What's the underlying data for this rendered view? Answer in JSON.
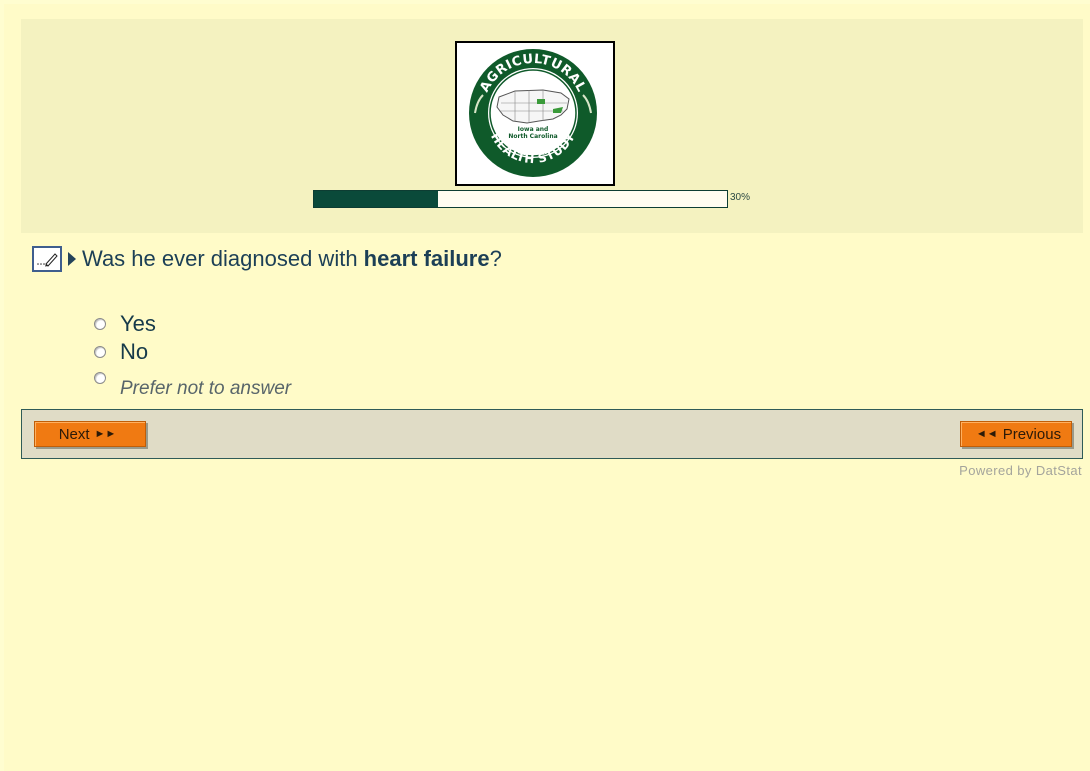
{
  "logo": {
    "alt": "Agricultural Health Study logo",
    "ring_top_text": "AGRICULTURAL",
    "ring_bottom_text": "HEALTH STUDY",
    "center_text_line1": "Iowa and",
    "center_text_line2": "North Carolina"
  },
  "progress": {
    "percent": 30,
    "label": "30%"
  },
  "question": {
    "prefix": "Was he ever diagnosed with ",
    "emphasis": "heart failure",
    "suffix": "?"
  },
  "options": [
    {
      "label": "Yes"
    },
    {
      "label": "No"
    },
    {
      "label": "Prefer not to answer"
    }
  ],
  "navigation": {
    "next_label": "Next",
    "previous_label": "Previous"
  },
  "footer": {
    "powered_by": "Powered by DatStat"
  },
  "colors": {
    "page_background": "#fffbc8",
    "banner_background": "#f4f2c0",
    "progress_fill": "#0a4a3a",
    "button_orange": "#f07a12",
    "nav_bar": "#e0dcc6",
    "logo_green": "#0f5a2a"
  }
}
